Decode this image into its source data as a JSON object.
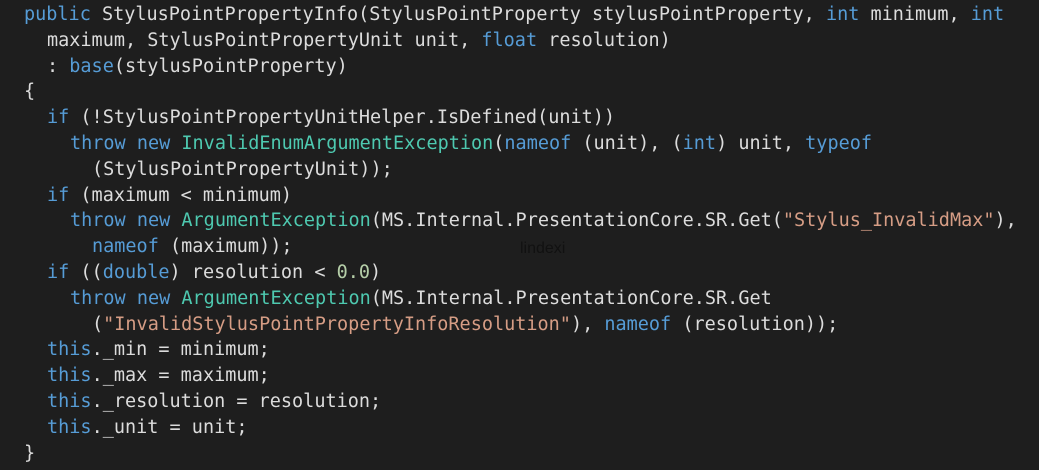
{
  "code_lines": [
    {
      "indent": 1,
      "tokens": [
        [
          "kw",
          "public"
        ],
        [
          "pl",
          " StylusPointPropertyInfo(StylusPointProperty stylusPointProperty, "
        ],
        [
          "kw",
          "int"
        ],
        [
          "pl",
          " minimum, "
        ],
        [
          "kw",
          "int"
        ]
      ]
    },
    {
      "indent": 2,
      "tokens": [
        [
          "pl",
          "maximum, StylusPointPropertyUnit unit, "
        ],
        [
          "kw",
          "float"
        ],
        [
          "pl",
          " resolution)"
        ]
      ]
    },
    {
      "indent": 2,
      "tokens": [
        [
          "pl",
          ": "
        ],
        [
          "kw",
          "base"
        ],
        [
          "pl",
          "(stylusPointProperty)"
        ]
      ]
    },
    {
      "indent": 1,
      "tokens": [
        [
          "pl",
          "{"
        ]
      ]
    },
    {
      "indent": 2,
      "tokens": [
        [
          "kw",
          "if"
        ],
        [
          "pl",
          " (!StylusPointPropertyUnitHelper.IsDefined(unit))"
        ]
      ]
    },
    {
      "indent": 3,
      "tokens": [
        [
          "kw",
          "throw"
        ],
        [
          "pl",
          " "
        ],
        [
          "kw",
          "new"
        ],
        [
          "pl",
          " "
        ],
        [
          "ty",
          "InvalidEnumArgumentException"
        ],
        [
          "pl",
          "("
        ],
        [
          "kw",
          "nameof"
        ],
        [
          "pl",
          " (unit), ("
        ],
        [
          "kw",
          "int"
        ],
        [
          "pl",
          ") unit, "
        ],
        [
          "kw",
          "typeof"
        ]
      ]
    },
    {
      "indent": 4,
      "tokens": [
        [
          "pl",
          "(StylusPointPropertyUnit));"
        ]
      ]
    },
    {
      "indent": 2,
      "tokens": [
        [
          "kw",
          "if"
        ],
        [
          "pl",
          " (maximum < minimum)"
        ]
      ]
    },
    {
      "indent": 3,
      "tokens": [
        [
          "kw",
          "throw"
        ],
        [
          "pl",
          " "
        ],
        [
          "kw",
          "new"
        ],
        [
          "pl",
          " "
        ],
        [
          "ty",
          "ArgumentException"
        ],
        [
          "pl",
          "(MS.Internal.PresentationCore.SR.Get("
        ],
        [
          "st",
          "\"Stylus_InvalidMax\""
        ],
        [
          "pl",
          "),"
        ]
      ]
    },
    {
      "indent": 4,
      "tokens": [
        [
          "kw",
          "nameof"
        ],
        [
          "pl",
          " (maximum));"
        ]
      ]
    },
    {
      "indent": 2,
      "tokens": [
        [
          "kw",
          "if"
        ],
        [
          "pl",
          " (("
        ],
        [
          "kw",
          "double"
        ],
        [
          "pl",
          ") resolution < "
        ],
        [
          "nm",
          "0.0"
        ],
        [
          "pl",
          ")"
        ]
      ]
    },
    {
      "indent": 3,
      "tokens": [
        [
          "kw",
          "throw"
        ],
        [
          "pl",
          " "
        ],
        [
          "kw",
          "new"
        ],
        [
          "pl",
          " "
        ],
        [
          "ty",
          "ArgumentException"
        ],
        [
          "pl",
          "(MS.Internal.PresentationCore.SR.Get"
        ]
      ]
    },
    {
      "indent": 4,
      "tokens": [
        [
          "pl",
          "("
        ],
        [
          "st",
          "\"InvalidStylusPointPropertyInfoResolution\""
        ],
        [
          "pl",
          "), "
        ],
        [
          "kw",
          "nameof"
        ],
        [
          "pl",
          " (resolution));"
        ]
      ]
    },
    {
      "indent": 2,
      "tokens": [
        [
          "kw",
          "this"
        ],
        [
          "pl",
          "._min = minimum;"
        ]
      ]
    },
    {
      "indent": 2,
      "tokens": [
        [
          "kw",
          "this"
        ],
        [
          "pl",
          "._max = maximum;"
        ]
      ]
    },
    {
      "indent": 2,
      "tokens": [
        [
          "kw",
          "this"
        ],
        [
          "pl",
          "._resolution = resolution;"
        ]
      ]
    },
    {
      "indent": 2,
      "tokens": [
        [
          "kw",
          "this"
        ],
        [
          "pl",
          "._unit = unit;"
        ]
      ]
    },
    {
      "indent": 1,
      "tokens": [
        [
          "pl",
          "}"
        ]
      ]
    }
  ],
  "watermark": "lindexi",
  "colors": {
    "background": "#1e1e1e",
    "plain": "#dcdcdc",
    "keyword": "#569cd6",
    "type": "#4ec9b0",
    "string": "#d69d85",
    "number": "#b5cea8"
  }
}
